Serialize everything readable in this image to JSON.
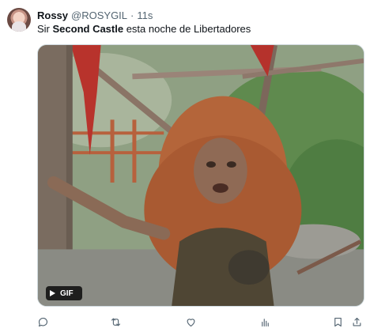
{
  "tweet": {
    "display_name": "Rossy",
    "handle": "@ROSYGIL",
    "separator": "·",
    "time": "11s",
    "text_before": "Sir ",
    "text_bold": "Second Castle",
    "text_after": " esta noche de Libertadores",
    "media": {
      "badge_label": "GIF",
      "alt": "GIF of a person with long curly red hair in a green garden setting"
    }
  },
  "actions": [
    {
      "icon": "reply-icon"
    },
    {
      "icon": "retweet-icon"
    },
    {
      "icon": "like-icon"
    },
    {
      "icon": "views-icon"
    },
    {
      "icon": "bookmark-icon"
    },
    {
      "icon": "share-icon"
    }
  ],
  "colors": {
    "text_primary": "#0f1419",
    "text_secondary": "#536471",
    "border": "#cfd9de"
  }
}
